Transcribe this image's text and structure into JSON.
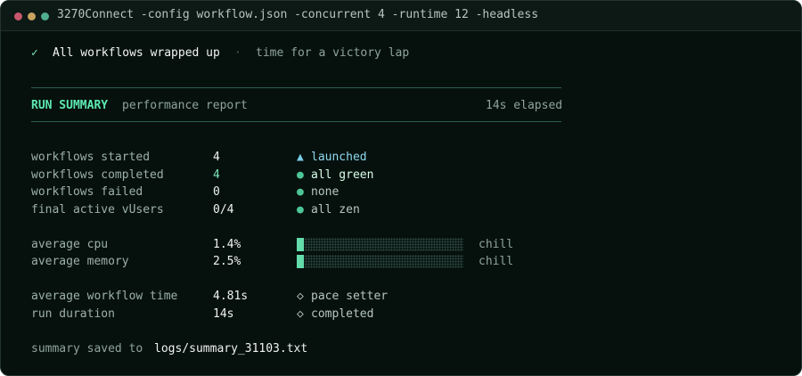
{
  "window": {
    "title": "3270Connect -config workflow.json -concurrent 4 -runtime 12 -headless"
  },
  "banner": {
    "check": "✓",
    "message": "All workflows wrapped up",
    "separator": "·",
    "tagline": "time for a victory lap"
  },
  "summary": {
    "heading": "RUN SUMMARY",
    "subheading": "performance report",
    "elapsed": "14s elapsed"
  },
  "workflow_stats": [
    {
      "label": "workflows started",
      "value": "4",
      "mark": "▲",
      "status": "launched",
      "tone": "blue"
    },
    {
      "label": "workflows completed",
      "value": "4",
      "mark": "●",
      "status": "all green",
      "tone": "bright"
    },
    {
      "label": "workflows failed",
      "value": "0",
      "mark": "●",
      "status": "none",
      "tone": "normal"
    },
    {
      "label": "final active vUsers",
      "value": "0/4",
      "mark": "●",
      "status": "all zen",
      "tone": "normal"
    }
  ],
  "resources": [
    {
      "label": "average cpu",
      "value": "1.4%",
      "fill_fraction": 0.014,
      "note": "chill"
    },
    {
      "label": "average memory",
      "value": "2.5%",
      "fill_fraction": 0.025,
      "note": "chill"
    }
  ],
  "timing": [
    {
      "label": "average workflow time",
      "value": "4.81s",
      "mark": "◇",
      "status": "pace setter"
    },
    {
      "label": "run duration",
      "value": "14s",
      "mark": "◇",
      "status": "completed"
    }
  ],
  "footer": {
    "prefix": "summary saved to",
    "path": "logs/summary_31103.txt"
  },
  "colors": {
    "accent": "#5ee8b0",
    "blue": "#79cde6",
    "background": "#06110e"
  }
}
